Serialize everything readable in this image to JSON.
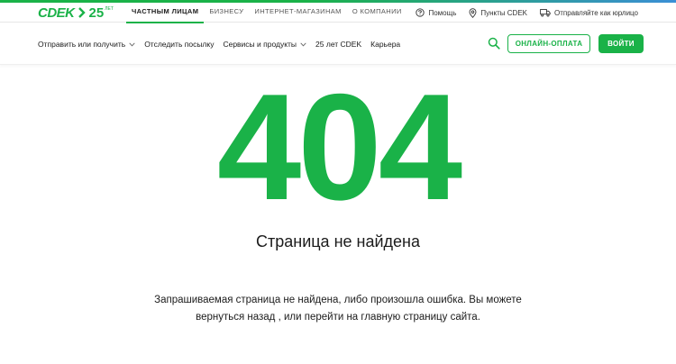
{
  "colors": {
    "accent": "#1ab248",
    "text": "#1b1b1b"
  },
  "logo": {
    "brand": "CDEK",
    "anniversary": "25",
    "anniversary_suffix": "ЛЕТ"
  },
  "topbar": {
    "links": [
      "ЧАСТНЫМ ЛИЦАМ",
      "БИЗНЕСУ",
      "ИНТЕРНЕТ-МАГАЗИНАМ",
      "О КОМПАНИИ"
    ],
    "active_index": 0,
    "help": "Помощь",
    "points": "Пункты CDEK",
    "send_legal": "Отправляйте как юрлицо"
  },
  "nav": {
    "items": [
      {
        "label": "Отправить или получить",
        "dropdown": true
      },
      {
        "label": "Отследить посылку",
        "dropdown": false
      },
      {
        "label": "Сервисы и продукты",
        "dropdown": true
      },
      {
        "label": "25 лет CDEK",
        "dropdown": false
      },
      {
        "label": "Карьера",
        "dropdown": false
      }
    ],
    "pay_label": "ОНЛАЙН-ОПЛАТА",
    "login_label": "ВОЙТИ"
  },
  "error": {
    "code": "404",
    "title": "Страница не найдена",
    "line1": "Запрашиваемая страница не найдена, либо произошла ошибка. Вы можете",
    "line2": "вернуться назад , или перейти на главную страницу сайта."
  }
}
